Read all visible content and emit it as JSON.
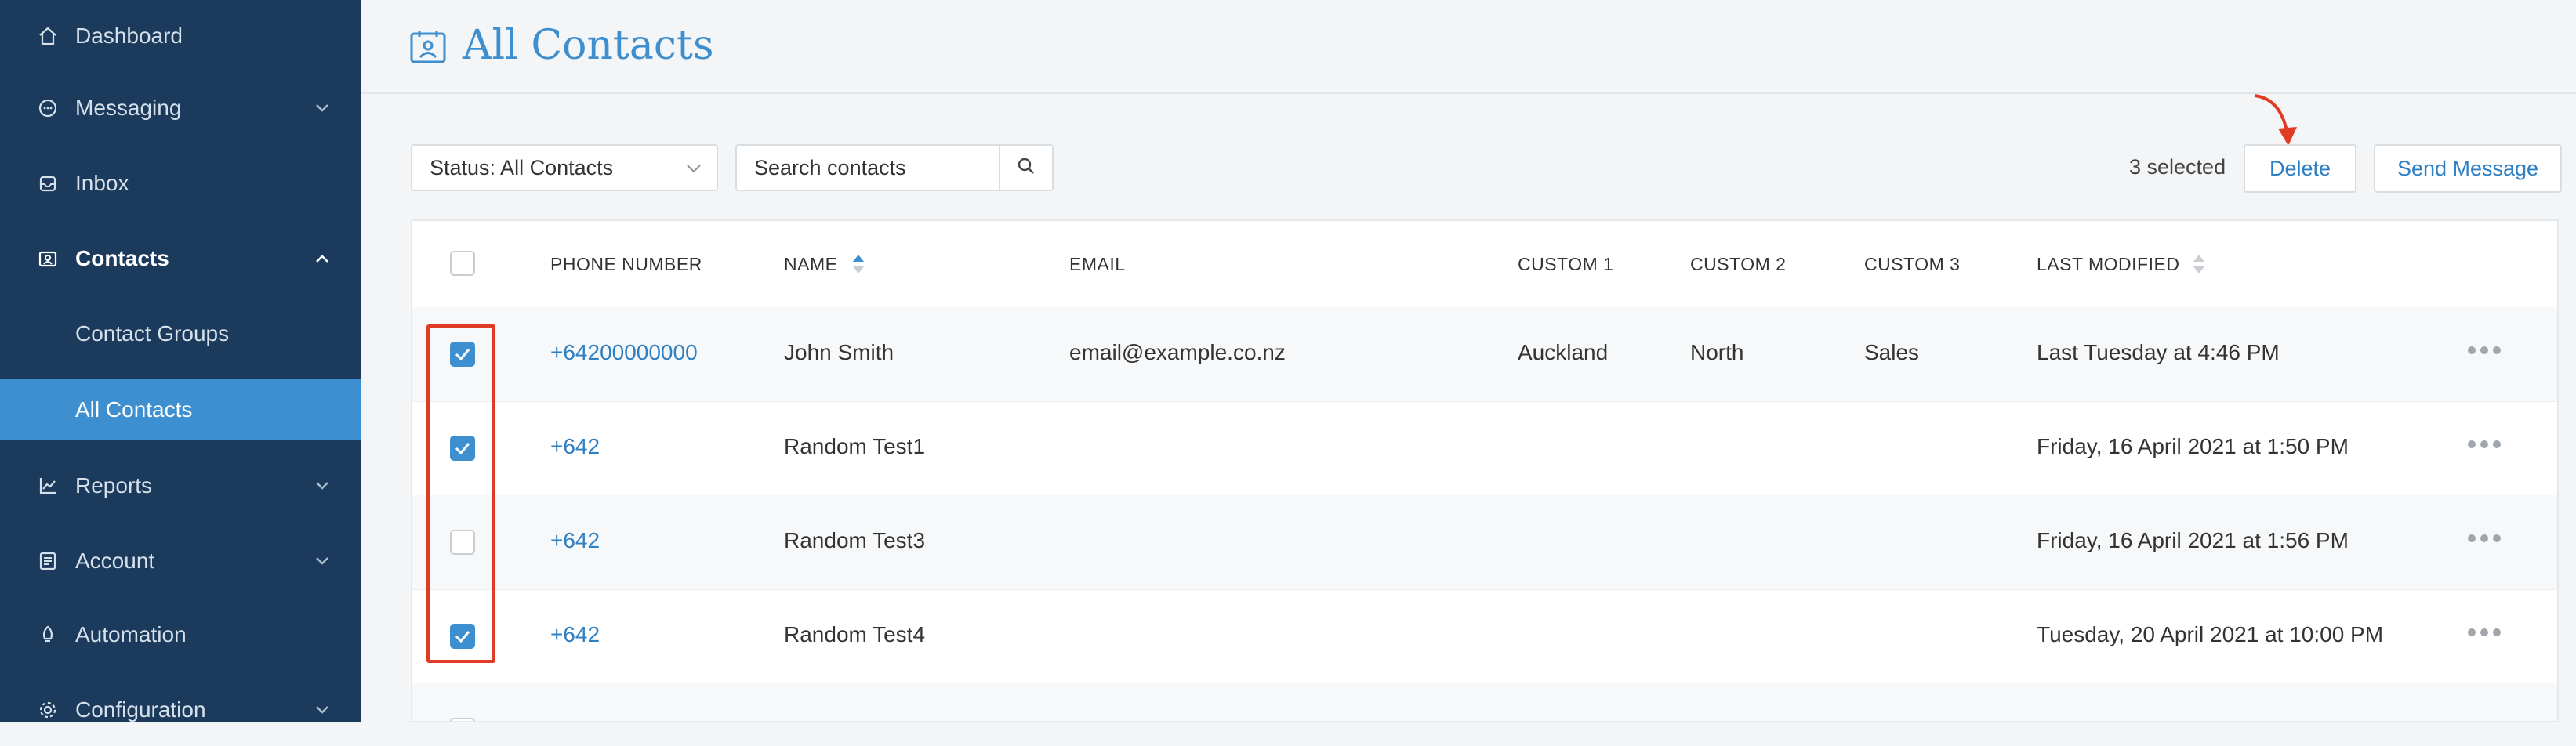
{
  "sidebar": {
    "items": [
      {
        "label": "Dashboard",
        "icon": "home-icon"
      },
      {
        "label": "Messaging",
        "icon": "chat-icon"
      },
      {
        "label": "Inbox",
        "icon": "inbox-icon"
      },
      {
        "label": "Contacts",
        "icon": "contacts-icon"
      },
      {
        "label": "Contact Groups"
      },
      {
        "label": "All Contacts"
      },
      {
        "label": "Reports",
        "icon": "chart-icon"
      },
      {
        "label": "Account",
        "icon": "account-icon"
      },
      {
        "label": "Automation",
        "icon": "rocket-icon"
      },
      {
        "label": "Configuration",
        "icon": "gear-icon"
      }
    ]
  },
  "header": {
    "title": "All Contacts"
  },
  "toolbar": {
    "status_filter": "Status: All Contacts",
    "search_placeholder": "Search contacts",
    "selected_count": "3 selected",
    "delete_label": "Delete",
    "send_label": "Send Message"
  },
  "table": {
    "columns": [
      "PHONE NUMBER",
      "NAME",
      "EMAIL",
      "CUSTOM 1",
      "CUSTOM 2",
      "CUSTOM 3",
      "LAST MODIFIED"
    ],
    "rows": [
      {
        "checked": true,
        "phone": "+64200000000",
        "name": "John Smith",
        "email": "email@example.co.nz",
        "custom1": "Auckland",
        "custom2": "North",
        "custom3": "Sales",
        "modified": "Last Tuesday at 4:46 PM"
      },
      {
        "checked": true,
        "phone": "+642",
        "name": "Random Test1",
        "email": "",
        "custom1": "",
        "custom2": "",
        "custom3": "",
        "modified": "Friday, 16 April 2021 at 1:50 PM"
      },
      {
        "checked": false,
        "phone": "+642",
        "name": "Random Test3",
        "email": "",
        "custom1": "",
        "custom2": "",
        "custom3": "",
        "modified": "Friday, 16 April 2021 at 1:56 PM"
      },
      {
        "checked": true,
        "phone": "+642",
        "name": "Random Test4",
        "email": "",
        "custom1": "",
        "custom2": "",
        "custom3": "",
        "modified": "Tuesday, 20 April 2021 at 10:00 PM"
      }
    ]
  },
  "colors": {
    "sidebar_bg": "#1b3a5c",
    "accent": "#3d8fd0",
    "link": "#2f7fc3",
    "annotation_red": "#e03b24"
  }
}
